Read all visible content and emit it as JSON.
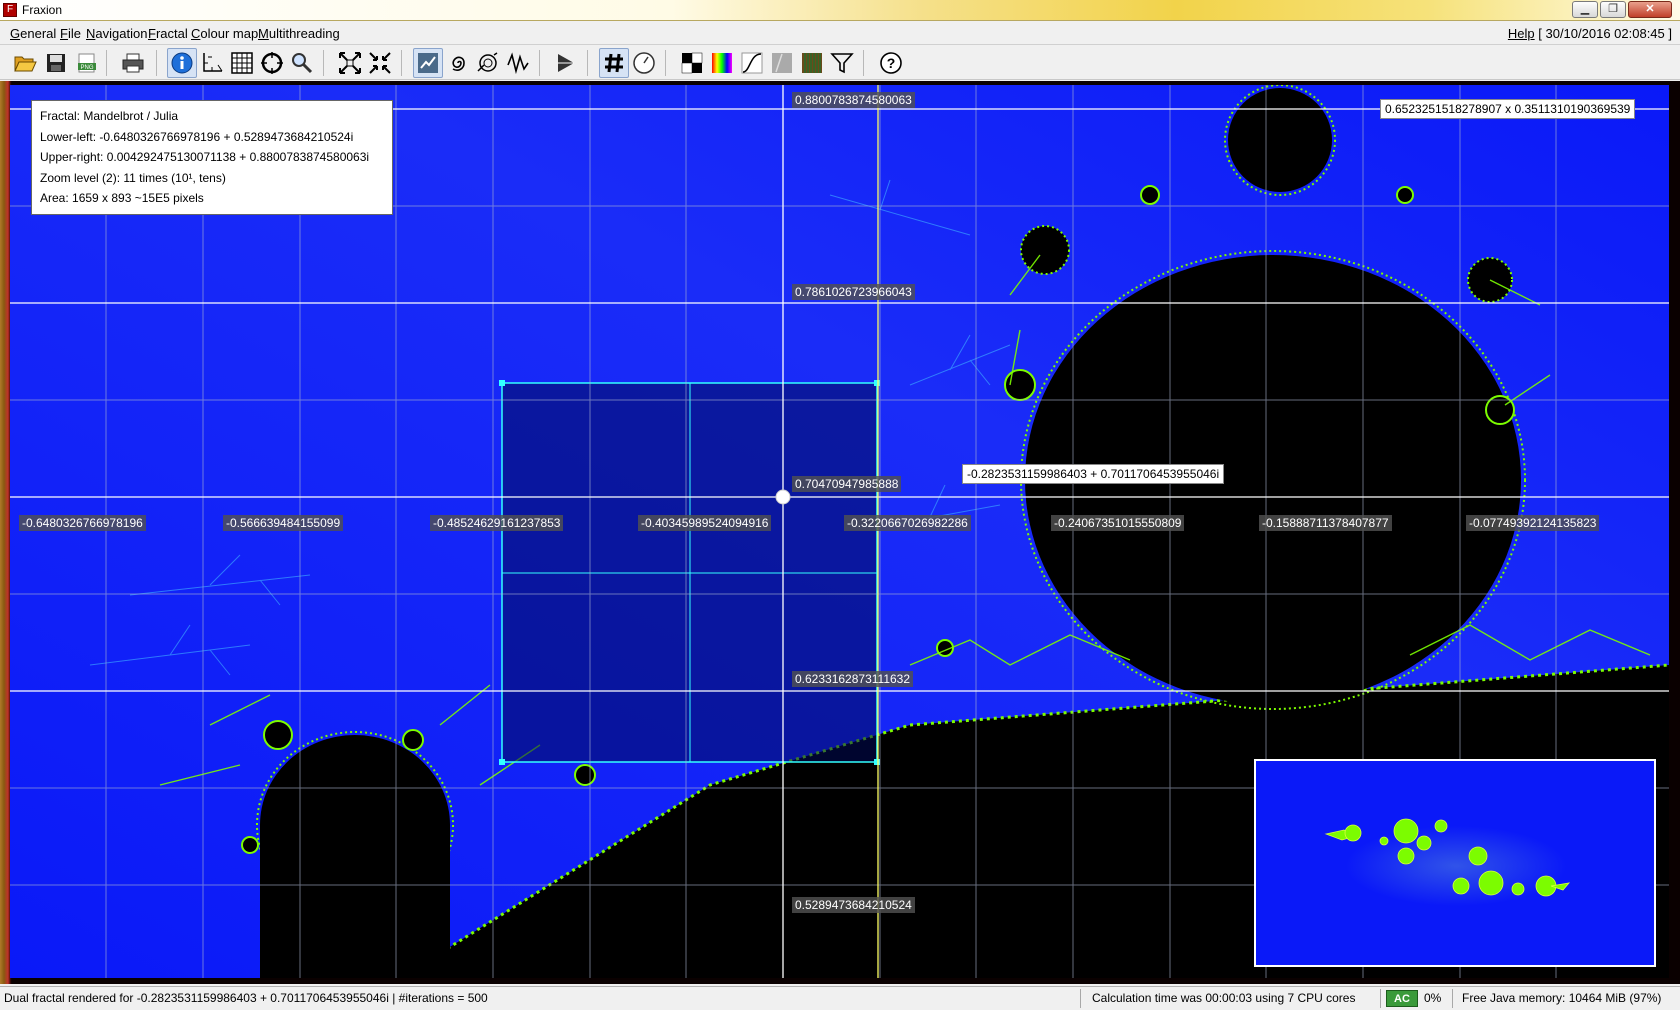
{
  "window": {
    "title": "Fraxion",
    "app_icon_glyph": "F",
    "buttons": {
      "minimize": "▁",
      "maximize": "❐",
      "close": "✕"
    }
  },
  "menu": {
    "items": [
      {
        "label": "General",
        "underline": "G",
        "rest": "eneral"
      },
      {
        "label": "File",
        "underline": "F",
        "rest": "ile"
      },
      {
        "label": "Navigation",
        "underline": "N",
        "rest": "avigation"
      },
      {
        "label": "Fractal",
        "underline": "F",
        "rest": "ractal"
      },
      {
        "label": "Colour map",
        "underline": "C",
        "rest": "olour map"
      },
      {
        "label": "Multithreading",
        "underline": "M",
        "rest": "ultithreading"
      }
    ],
    "help": "Help",
    "datetime": "[ 30/10/2016 02:08:45 ]"
  },
  "toolbar": {
    "icons": [
      "open-folder-icon",
      "save-disk-icon",
      "export-png-icon",
      "print-icon",
      "info-icon",
      "axes-icon",
      "grid-icon",
      "crosshair-icon",
      "magnifier-icon",
      "zoom-out-icon",
      "zoom-in-icon",
      "rotate-icon",
      "spiral-icon",
      "orbit-icon",
      "wave-icon",
      "play-animation-icon",
      "hash-icon",
      "clock-gauge-icon",
      "checker-colour-icon",
      "rainbow-colour-icon",
      "curve-icon",
      "gradient-icon",
      "palette-bars-icon",
      "filter-icon",
      "help-question-icon"
    ],
    "png_badge": "PNG"
  },
  "info_panel": {
    "fractal": "Fractal: Mandelbrot / Julia",
    "lower_left": "Lower-left: -0.6480326766978196 + 0.5289473684210524i",
    "upper_right": "Upper-right: 0.004292475130071138 + 0.8800783874580063i",
    "zoom": "Zoom level (2): 11 times (10¹, tens)",
    "area": "Area: 1659 x 893 ~15E5 pixels"
  },
  "overlay": {
    "dimensions": "0.6523251518278907 x 0.3511310190369539",
    "cursor_value": "-0.2823531159986403 + 0.7011706453955046i",
    "y_labels": [
      "0.8800783874580063",
      "0.7861026723966043",
      "0.70470947985888",
      "0.6233162873111632",
      "0.5289473684210524"
    ],
    "x_labels": [
      "-0.6480326766978196",
      "-0.566639484155099",
      "-0.48524629161237853",
      "-0.40345989524094916",
      "-0.3220667026982286",
      "-0.24067351015550809",
      "-0.15888711378407877",
      "-0.07749392124135823"
    ]
  },
  "status": {
    "message": "Dual fractal rendered for -0.2823531159986403 + 0.7011706453955046i  |  #iterations = 500",
    "calc_time": "Calculation time was 00:00:03 using 7 CPU cores",
    "ac_badge": "AC",
    "cpu_load": "0%",
    "memory": "Free Java memory: 10464 MiB (97%)"
  },
  "colors": {
    "fractal_background": "#0a19f8",
    "fractal_set": "#000000",
    "fractal_edge": "#7cfc00",
    "selection": "#33ffff",
    "grid": "#ffffff"
  }
}
